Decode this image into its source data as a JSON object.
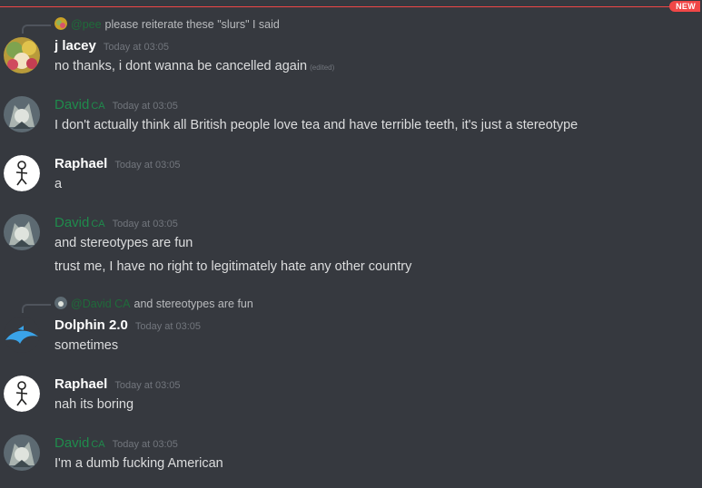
{
  "divider": {
    "badge": "NEW"
  },
  "messages": [
    {
      "reply": {
        "name": "@pee",
        "text": "please reiterate these \"slurs\" I said"
      },
      "author": "j lacey",
      "time": "Today at 03:05",
      "lines": [
        "no thanks, i dont wanna be cancelled again"
      ],
      "edited": "(edited)"
    },
    {
      "author": "David",
      "tag": "CA",
      "time": "Today at 03:05",
      "lines": [
        "I don't actually think all British people love tea and have terrible teeth, it's just a stereotype"
      ]
    },
    {
      "author": "Raphael",
      "time": "Today at 03:05",
      "lines": [
        "a"
      ]
    },
    {
      "author": "David",
      "tag": "CA",
      "time": "Today at 03:05",
      "lines": [
        "and stereotypes are fun",
        "trust me, I have no right to legitimately hate any other country"
      ]
    },
    {
      "reply": {
        "name": "@David CA",
        "text": "and stereotypes are fun"
      },
      "author": "Dolphin 2.0",
      "time": "Today at 03:05",
      "lines": [
        "sometimes"
      ]
    },
    {
      "author": "Raphael",
      "time": "Today at 03:05",
      "lines": [
        "nah its boring"
      ]
    },
    {
      "author": "David",
      "tag": "CA",
      "time": "Today at 03:05",
      "lines": [
        "I'm a dumb fucking American"
      ]
    }
  ],
  "colors": {
    "background": "#36393f",
    "role_green": "#1f8b4c",
    "new_red": "#f04747",
    "timestamp": "#72767d"
  }
}
